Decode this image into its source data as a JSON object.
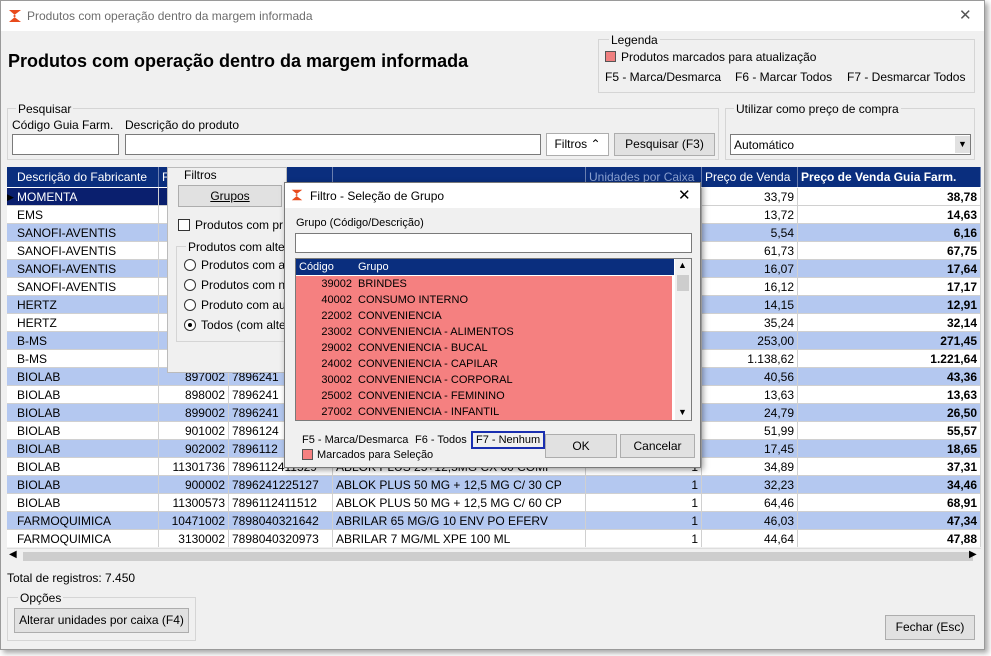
{
  "window": {
    "title": "Produtos com operação dentro da margem informada",
    "close": "✕"
  },
  "page": {
    "heading": "Produtos com operação dentro da margem informada"
  },
  "legend": {
    "title": "Legenda",
    "item": "Produtos marcados para atualização",
    "swatch": "#f08080",
    "keys": [
      "F5 - Marca/Desmarca",
      "F6 - Marcar Todos",
      "F7 - Desmarcar Todos"
    ]
  },
  "search": {
    "title": "Pesquisar",
    "codigo_label": "Código Guia Farm.",
    "descricao_label": "Descrição do produto",
    "filtros_btn": "Filtros",
    "pesquisar_btn": "Pesquisar (F3)"
  },
  "preco": {
    "title": "Utilizar como preço de compra",
    "value": "Automático"
  },
  "filtros": {
    "title": "Filtros",
    "grupos_btn": "Grupos",
    "chk": "Produtos com pr",
    "radio_title": "Produtos com alte",
    "radios": [
      "Produtos com a",
      "Produtos com n",
      "Produto com au",
      "Todos (com alte"
    ]
  },
  "grid": {
    "headers": [
      "Descrição do Fabricante",
      "F",
      "",
      "",
      "Unidades por Caixa",
      "Preço de Venda",
      "Preço de Venda Guia Farm."
    ],
    "rows": [
      {
        "fab": "MOMENTA",
        "cod": "",
        "ean": "",
        "desc": "",
        "un": "",
        "pv": "33,79",
        "pvg": "38,78",
        "blue": false,
        "sel": true
      },
      {
        "fab": "EMS",
        "cod": "",
        "ean": "",
        "desc": "",
        "un": "",
        "pv": "13,72",
        "pvg": "14,63",
        "blue": false
      },
      {
        "fab": "SANOFI-AVENTIS",
        "cod": "",
        "ean": "",
        "desc": "",
        "un": "",
        "pv": "5,54",
        "pvg": "6,16",
        "blue": true
      },
      {
        "fab": "SANOFI-AVENTIS",
        "cod": "",
        "ean": "",
        "desc": "",
        "un": "",
        "pv": "61,73",
        "pvg": "67,75",
        "blue": false
      },
      {
        "fab": "SANOFI-AVENTIS",
        "cod": "",
        "ean": "",
        "desc": "",
        "un": "",
        "pv": "16,07",
        "pvg": "17,64",
        "blue": true
      },
      {
        "fab": "SANOFI-AVENTIS",
        "cod": "",
        "ean": "",
        "desc": "",
        "un": "",
        "pv": "16,12",
        "pvg": "17,17",
        "blue": false
      },
      {
        "fab": "HERTZ",
        "cod": "",
        "ean": "",
        "desc": "",
        "un": "",
        "pv": "14,15",
        "pvg": "12,91",
        "blue": true
      },
      {
        "fab": "HERTZ",
        "cod": "",
        "ean": "",
        "desc": "",
        "un": "",
        "pv": "35,24",
        "pvg": "32,14",
        "blue": false
      },
      {
        "fab": "B-MS",
        "cod": "",
        "ean": "",
        "desc": "",
        "un": "",
        "pv": "253,00",
        "pvg": "271,45",
        "blue": true
      },
      {
        "fab": "B-MS",
        "cod": "",
        "ean": "",
        "desc": "",
        "un": "",
        "pv": "1.138,62",
        "pvg": "1.221,64",
        "blue": false
      },
      {
        "fab": "BIOLAB",
        "cod": "897002",
        "ean": "7896241",
        "desc": "",
        "un": "",
        "pv": "40,56",
        "pvg": "43,36",
        "blue": true
      },
      {
        "fab": "BIOLAB",
        "cod": "898002",
        "ean": "7896241",
        "desc": "",
        "un": "",
        "pv": "13,63",
        "pvg": "13,63",
        "blue": false
      },
      {
        "fab": "BIOLAB",
        "cod": "899002",
        "ean": "7896241",
        "desc": "",
        "un": "",
        "pv": "24,79",
        "pvg": "26,50",
        "blue": true
      },
      {
        "fab": "BIOLAB",
        "cod": "901002",
        "ean": "7896124",
        "desc": "",
        "un": "",
        "pv": "51,99",
        "pvg": "55,57",
        "blue": false
      },
      {
        "fab": "BIOLAB",
        "cod": "902002",
        "ean": "7896112",
        "desc": "",
        "un": "",
        "pv": "17,45",
        "pvg": "18,65",
        "blue": true
      },
      {
        "fab": "BIOLAB",
        "cod": "11301736",
        "ean": "7896112411529",
        "desc": "ABLOK PLUS 25+12,5MG CX 60 COMP",
        "un": "1",
        "pv": "34,89",
        "pvg": "37,31",
        "blue": false
      },
      {
        "fab": "BIOLAB",
        "cod": "900002",
        "ean": "7896241225127",
        "desc": "ABLOK PLUS 50 MG + 12,5 MG C/ 30 CP",
        "un": "1",
        "pv": "32,23",
        "pvg": "34,46",
        "blue": true
      },
      {
        "fab": "BIOLAB",
        "cod": "11300573",
        "ean": "7896112411512",
        "desc": "ABLOK PLUS 50 MG + 12,5 MG C/ 60 CP",
        "un": "1",
        "pv": "64,46",
        "pvg": "68,91",
        "blue": false
      },
      {
        "fab": "FARMOQUIMICA",
        "cod": "10471002",
        "ean": "7898040321642",
        "desc": "ABRILAR 65 MG/G 10 ENV PO EFERV",
        "un": "1",
        "pv": "46,03",
        "pvg": "47,34",
        "blue": true
      },
      {
        "fab": "FARMOQUIMICA",
        "cod": "3130002",
        "ean": "7898040320973",
        "desc": "ABRILAR 7 MG/ML XPE 100 ML",
        "un": "1",
        "pv": "44,64",
        "pvg": "47,88",
        "blue": false
      }
    ]
  },
  "footer": {
    "total": "Total de registros: 7.450",
    "opcoes_title": "Opções",
    "alterar_btn": "Alterar unidades por caixa (F4)",
    "fechar_btn": "Fechar (Esc)"
  },
  "dialog": {
    "title": "Filtro - Seleção de Grupo",
    "close": "✕",
    "search_label": "Grupo (Código/Descrição)",
    "col_codigo": "Código",
    "col_grupo": "Grupo",
    "items": [
      {
        "codigo": "39002",
        "grupo": "BRINDES"
      },
      {
        "codigo": "40002",
        "grupo": "CONSUMO INTERNO"
      },
      {
        "codigo": "22002",
        "grupo": "CONVENIENCIA"
      },
      {
        "codigo": "23002",
        "grupo": "CONVENIENCIA - ALIMENTOS"
      },
      {
        "codigo": "29002",
        "grupo": "CONVENIENCIA - BUCAL"
      },
      {
        "codigo": "24002",
        "grupo": "CONVENIENCIA - CAPILAR"
      },
      {
        "codigo": "30002",
        "grupo": "CONVENIENCIA - CORPORAL"
      },
      {
        "codigo": "25002",
        "grupo": "CONVENIENCIA - FEMININO"
      },
      {
        "codigo": "27002",
        "grupo": "CONVENIENCIA - INFANTIL"
      }
    ],
    "keys": [
      "F5 - Marca/Desmarca",
      "F6 - Todos",
      "F7 - Nenhum"
    ],
    "legend": "Marcados para Seleção",
    "ok": "OK",
    "cancelar": "Cancelar"
  }
}
